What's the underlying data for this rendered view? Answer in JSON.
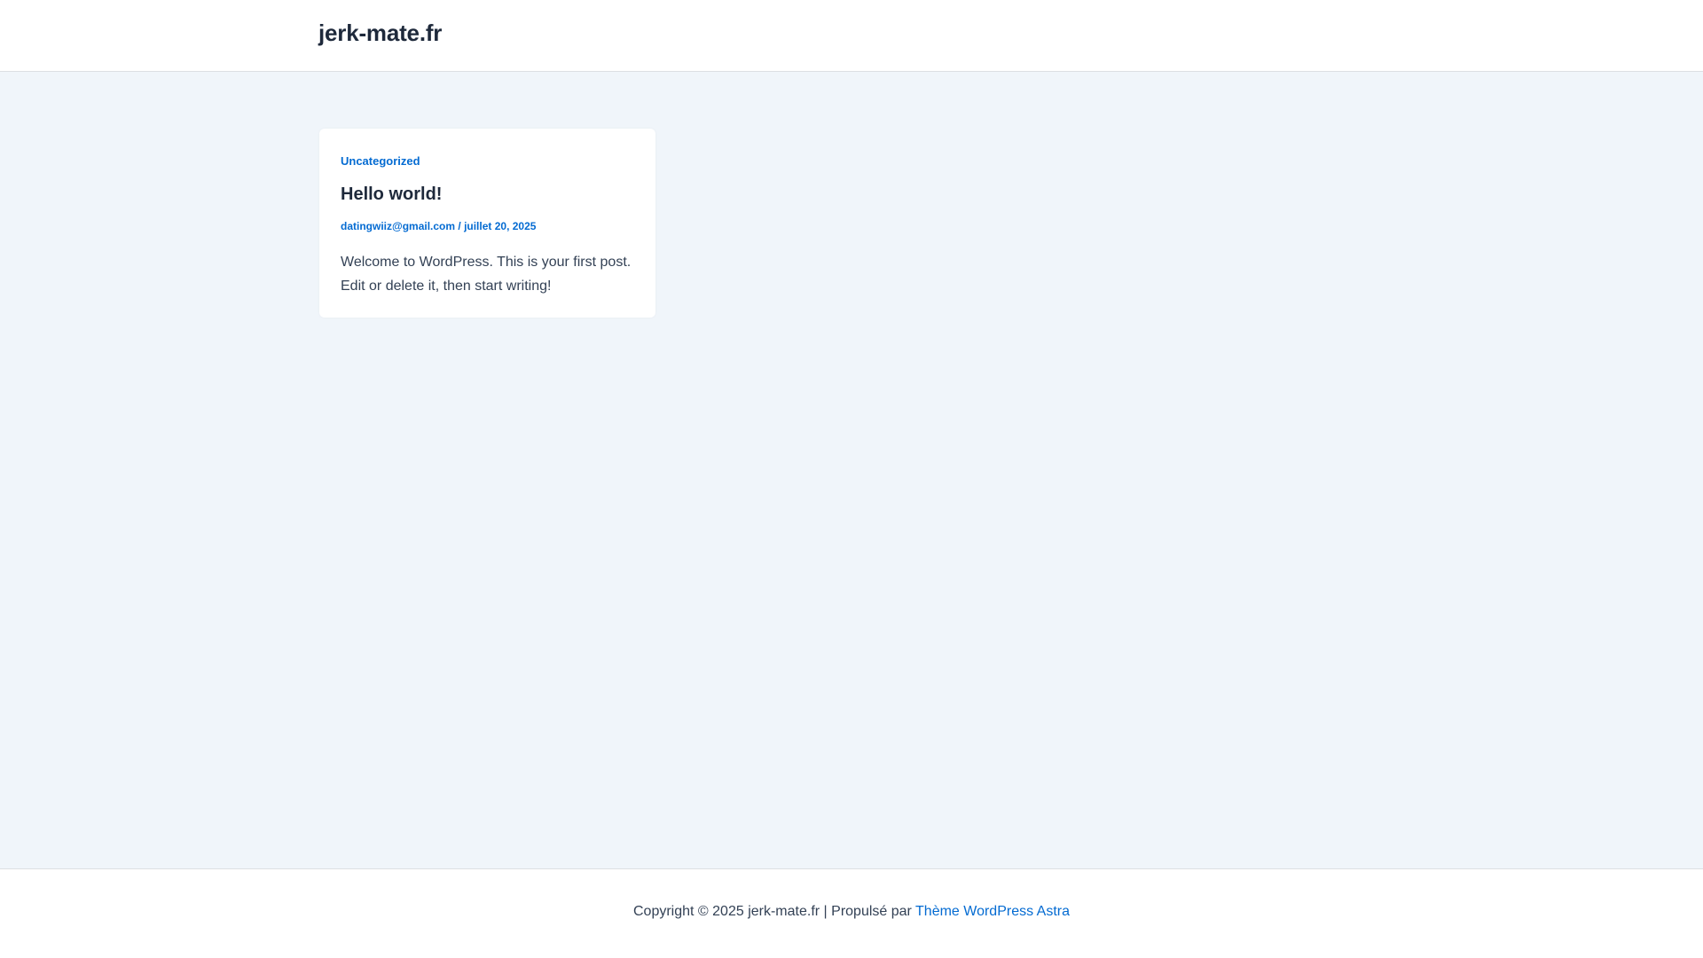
{
  "header": {
    "site_title": "jerk-mate.fr"
  },
  "post": {
    "category": "Uncategorized",
    "title": "Hello world!",
    "author": "datingwiiz@gmail.com",
    "meta_separator": " / ",
    "date": "juillet 20, 2025",
    "excerpt_line1": "Welcome to WordPress. This is your first post.",
    "excerpt_line2": "Edit or delete it, then start writing!"
  },
  "footer": {
    "copyright": "Copyright © 2025 jerk-mate.fr | Propulsé par ",
    "theme_link": "Thème WordPress Astra"
  },
  "colors": {
    "accent": "#046bd2",
    "heading": "#1e293b",
    "body_text": "#334155",
    "page_background": "#f0f5fa",
    "surface": "#ffffff"
  }
}
